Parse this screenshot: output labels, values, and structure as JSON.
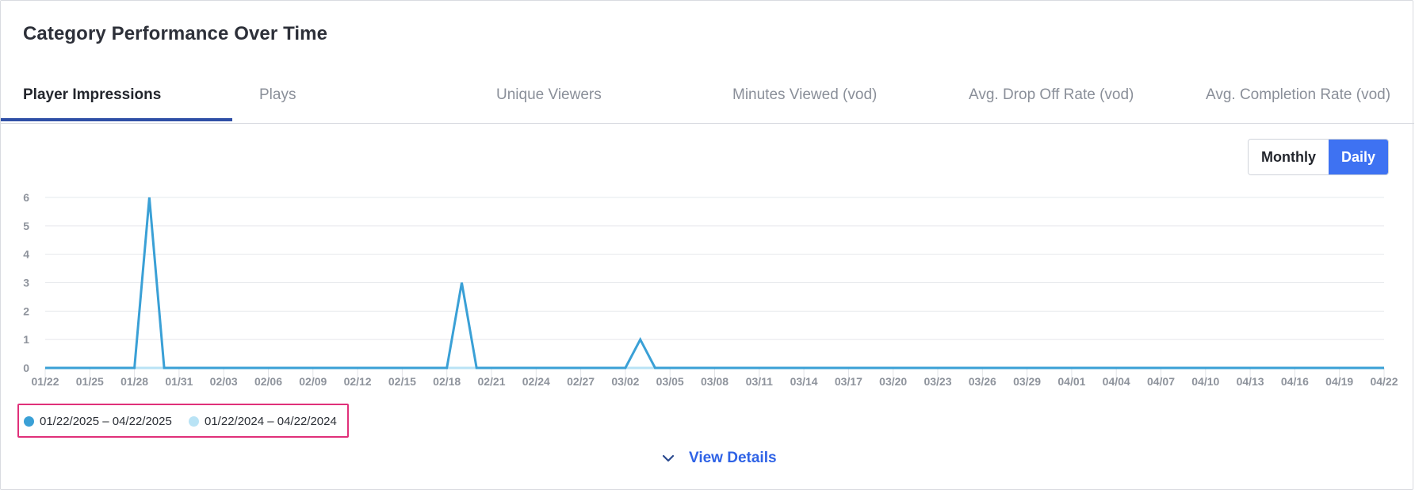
{
  "title": "Category Performance Over Time",
  "tabs": [
    {
      "label": "Player Impressions",
      "active": true
    },
    {
      "label": "Plays",
      "active": false
    },
    {
      "label": "Unique Viewers",
      "active": false
    },
    {
      "label": "Minutes Viewed (vod)",
      "active": false
    },
    {
      "label": "Avg. Drop Off Rate (vod)",
      "active": false
    },
    {
      "label": "Avg. Completion Rate (vod)",
      "active": false
    }
  ],
  "granularity": {
    "monthly_label": "Monthly",
    "daily_label": "Daily",
    "selected": "Daily"
  },
  "colors": {
    "current_series": "#3aa0d6",
    "previous_series": "#b9e3f5",
    "accent": "#3e72f2",
    "tab_underline": "#2f4fa6",
    "highlight_border": "#e0307a"
  },
  "chart_data": {
    "type": "line",
    "ylim": [
      0,
      6
    ],
    "yticks": [
      0,
      1,
      2,
      3,
      4,
      5,
      6
    ],
    "x_tick_labels": [
      "01/22",
      "01/25",
      "01/28",
      "01/31",
      "02/03",
      "02/06",
      "02/09",
      "02/12",
      "02/15",
      "02/18",
      "02/21",
      "02/24",
      "02/27",
      "03/02",
      "03/05",
      "03/08",
      "03/11",
      "03/14",
      "03/17",
      "03/20",
      "03/23",
      "03/26",
      "03/29",
      "04/01",
      "04/04",
      "04/07",
      "04/10",
      "04/13",
      "04/16",
      "04/19",
      "04/22"
    ],
    "grid": true,
    "legend_position": "bottom-left",
    "series": [
      {
        "name": "01/22/2025 – 04/22/2025",
        "color": "#3aa0d6",
        "points": [
          {
            "x": "01/22",
            "y": 0
          },
          {
            "x": "01/28",
            "y": 0
          },
          {
            "x": "01/29",
            "y": 6
          },
          {
            "x": "01/30",
            "y": 0
          },
          {
            "x": "02/18",
            "y": 0
          },
          {
            "x": "02/19",
            "y": 3
          },
          {
            "x": "02/20",
            "y": 0
          },
          {
            "x": "03/02",
            "y": 0
          },
          {
            "x": "03/03",
            "y": 1
          },
          {
            "x": "03/04",
            "y": 0
          },
          {
            "x": "04/22",
            "y": 0
          }
        ]
      },
      {
        "name": "01/22/2024 – 04/22/2024",
        "color": "#b9e3f5",
        "points": [
          {
            "x": "01/22",
            "y": 0
          },
          {
            "x": "04/22",
            "y": 0
          }
        ]
      }
    ]
  },
  "view_details_label": "View Details"
}
